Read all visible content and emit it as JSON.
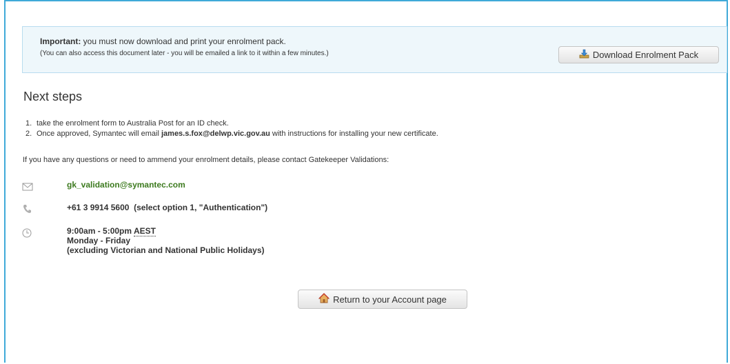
{
  "notice": {
    "important_label": "Important:",
    "message": "you must now download and print your enrolment pack.",
    "sub_message": "(You can also access this document later - you will be emailed a link to it within a few minutes.)",
    "download_button": "Download Enrolment Pack"
  },
  "next_steps": {
    "title": "Next steps",
    "steps": [
      {
        "num": "1.",
        "text": "take the enrolment form to Australia Post for an ID check."
      },
      {
        "num": "2.",
        "prefix": "Once approved, Symantec will email",
        "email": "james.s.fox@delwp.vic.gov.au",
        "suffix": "with instructions for installing your new certificate."
      }
    ]
  },
  "questions": "If you have any questions or need to ammend your enrolment details, please contact Gatekeeper Validations:",
  "contact": {
    "email": "gk_validation@symantec.com",
    "phone": "+61 3 9914 5600",
    "phone_note": "(select option 1, \"Authentication\")",
    "hours_time": "9:00am - 5:00pm",
    "hours_zone": "AEST",
    "hours_days": "Monday - Friday",
    "hours_exclusion": "(excluding Victorian and National Public Holidays)"
  },
  "return_button": "Return to your Account page",
  "icons": {
    "download": "download-icon",
    "email": "envelope-icon",
    "phone": "phone-icon",
    "clock": "clock-icon",
    "home": "home-icon"
  },
  "colors": {
    "frame_border": "#3fa9d8",
    "notice_bg": "#eef7fb",
    "link_green": "#3c7a1e"
  }
}
